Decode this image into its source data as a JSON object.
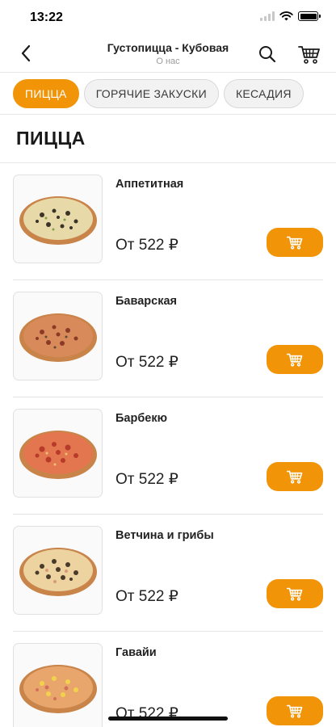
{
  "status": {
    "time": "13:22"
  },
  "header": {
    "title": "Густопицца - Кубовая",
    "subtitle": "О нас",
    "back_icon": "chevron-left-icon",
    "search_icon": "search-icon",
    "cart_icon": "cart-icon"
  },
  "categories": [
    {
      "label": "ПИЦЦА",
      "active": true
    },
    {
      "label": "ГОРЯЧИЕ ЗАКУСКИ",
      "active": false
    },
    {
      "label": "КЕСАДИЯ",
      "active": false
    }
  ],
  "section": {
    "title": "ПИЦЦА"
  },
  "products": [
    {
      "name": "Аппетитная",
      "price": "От 522 ₽"
    },
    {
      "name": "Баварская",
      "price": "От 522 ₽"
    },
    {
      "name": "Барбекю",
      "price": "От 522 ₽"
    },
    {
      "name": "Ветчина и грибы",
      "price": "От 522 ₽"
    },
    {
      "name": "Гавайи",
      "price": "От 522 ₽"
    }
  ],
  "colors": {
    "accent": "#f29408",
    "tab_inactive_bg": "#f2f2f2",
    "divider": "#e6e6e6"
  }
}
